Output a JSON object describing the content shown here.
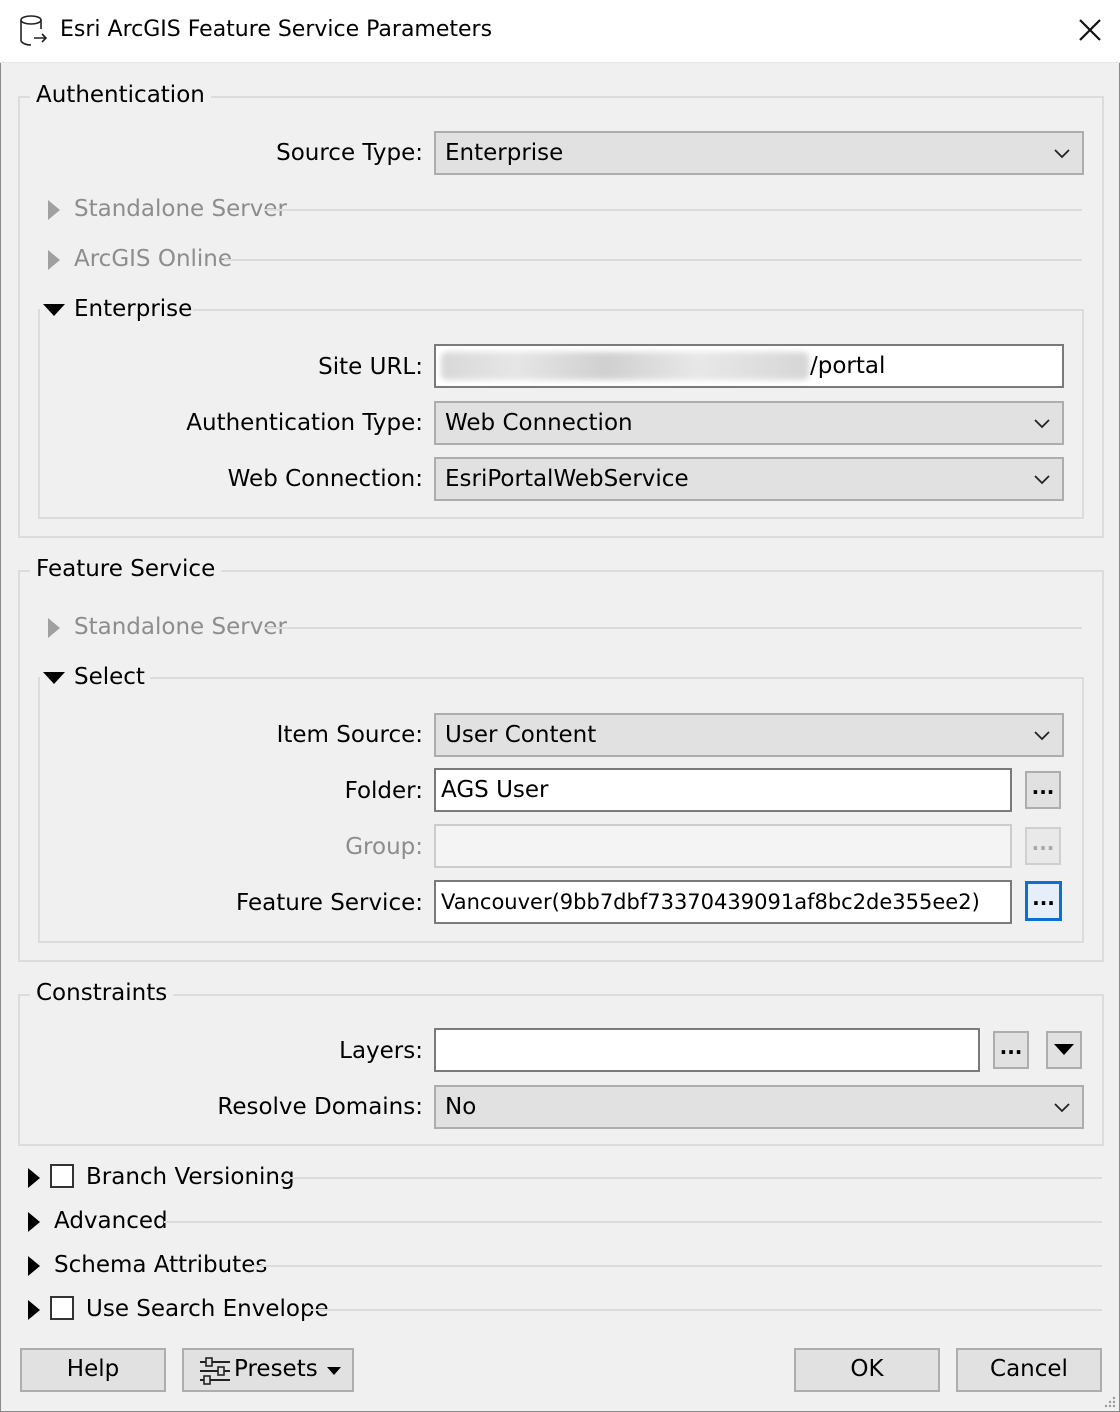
{
  "window": {
    "title": "Esri ArcGIS Feature Service Parameters",
    "icon": "database-export-icon",
    "close_icon": "close-icon"
  },
  "authentication": {
    "legend": "Authentication",
    "source_type_label": "Source Type:",
    "source_type_value": "Enterprise",
    "standalone_server_label": "Standalone Server",
    "arcgis_online_label": "ArcGIS Online",
    "enterprise_label": "Enterprise",
    "site_url_label": "Site URL:",
    "site_url_value": "/portal",
    "auth_type_label": "Authentication Type:",
    "auth_type_value": "Web Connection",
    "web_connection_label": "Web Connection:",
    "web_connection_value": "EsriPortalWebService"
  },
  "feature_service": {
    "legend": "Feature Service",
    "standalone_server_label": "Standalone Server",
    "select_label": "Select",
    "item_source_label": "Item Source:",
    "item_source_value": "User Content",
    "folder_label": "Folder:",
    "folder_value": "AGS User",
    "group_label": "Group:",
    "group_value": "",
    "feature_service_label": "Feature Service:",
    "feature_service_value": "Vancouver(9bb7dbf73370439091af8bc2de355ee2)",
    "browse_label": "..."
  },
  "constraints": {
    "legend": "Constraints",
    "layers_label": "Layers:",
    "layers_value": "",
    "resolve_domains_label": "Resolve Domains:",
    "resolve_domains_value": "No"
  },
  "sections": {
    "branch_versioning": "Branch Versioning",
    "advanced": "Advanced",
    "schema_attributes": "Schema Attributes",
    "use_search_envelope": "Use Search Envelope"
  },
  "footer": {
    "help": "Help",
    "presets": "Presets",
    "ok": "OK",
    "cancel": "Cancel"
  },
  "colors": {
    "focus_accent": "#0b6fd6",
    "disabled_text": "#8d8d8d"
  }
}
